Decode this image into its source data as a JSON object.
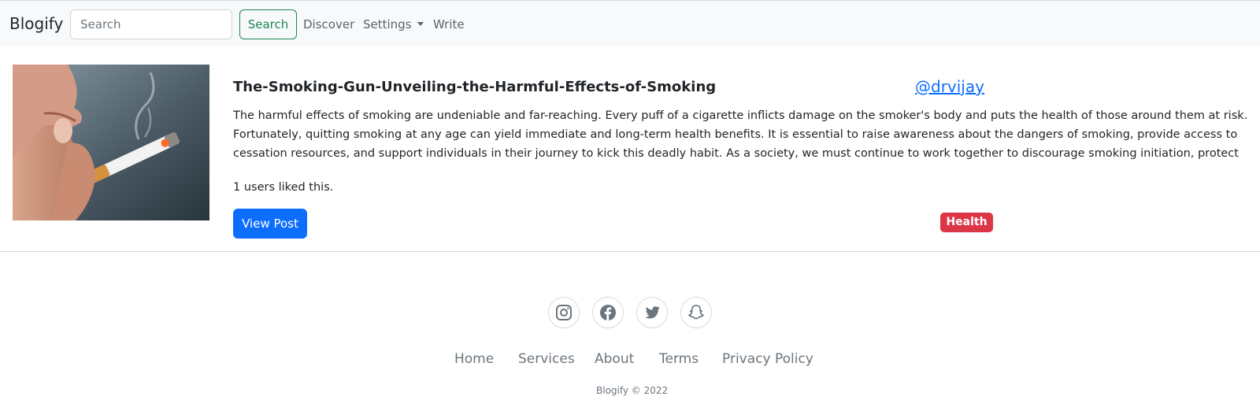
{
  "navbar": {
    "brand": "Blogify",
    "search_placeholder": "Search",
    "search_value": "",
    "search_button": "Search",
    "links": [
      "Discover",
      "Settings",
      "Write"
    ]
  },
  "post": {
    "title": "The-Smoking-Gun-Unveiling-the-Harmful-Effects-of-Smoking",
    "author": "@drvijay",
    "excerpt": "The harmful effects of smoking are undeniable and far-reaching. Every puff of a cigarette inflicts damage on the smoker's body and puts the health of those around them at risk. Fortunately, quitting smoking at any age can yield immediate and long-term health benefits. It is essential to raise awareness about the dangers of smoking, provide access to cessation resources, and support individuals in their journey to kick this deadly habit. As a society, we must continue to work together to discourage smoking initiation, protect non-",
    "likes": "1 users liked this.",
    "view_button": "View Post",
    "tag": "Health"
  },
  "footer": {
    "social_icons": [
      "instagram-icon",
      "facebook-icon",
      "twitter-icon",
      "snapchat-icon"
    ],
    "links": [
      "Home",
      "Services",
      "About",
      "Terms",
      "Privacy Policy"
    ],
    "copyright": "Blogify © 2022"
  },
  "colors": {
    "navbar_bg": "#f8f9fa",
    "primary": "#0d6efd",
    "success": "#198754",
    "danger": "#dc3545",
    "muted": "#6c757d"
  }
}
